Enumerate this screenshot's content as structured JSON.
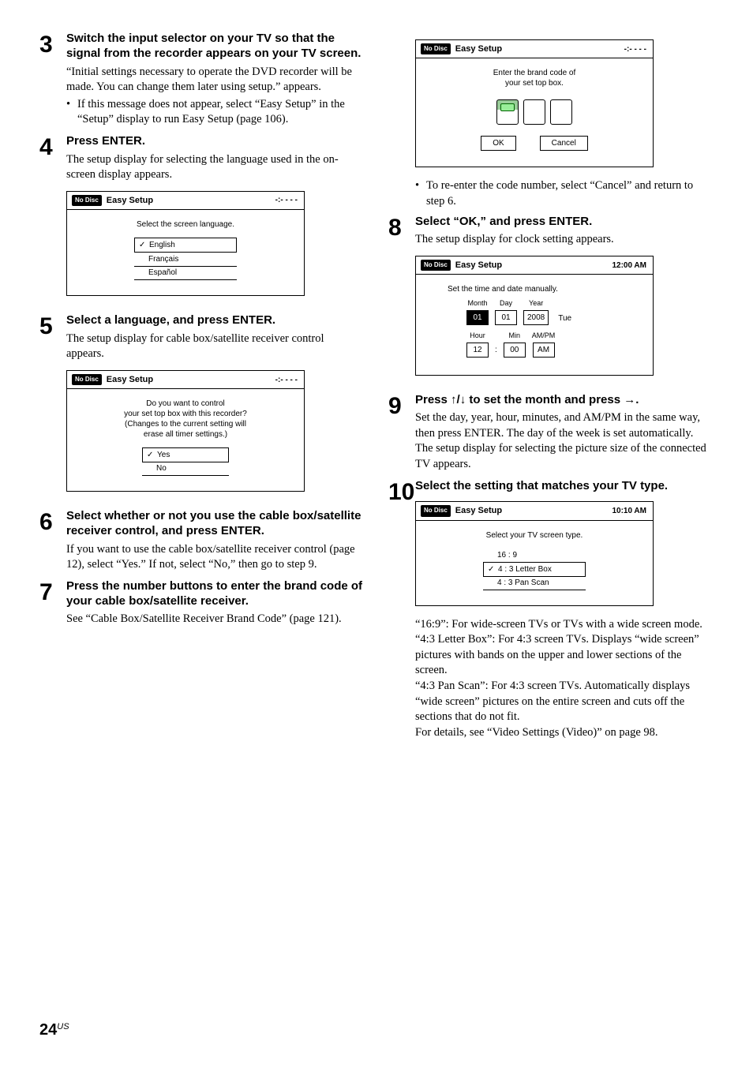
{
  "page_number": "24",
  "page_region": "US",
  "left": {
    "s3": {
      "title": "Switch the input selector on your TV so that the signal from the recorder appears on your TV screen.",
      "p1": "“Initial settings necessary to operate the DVD recorder will be made. You can change them later using setup.” appears.",
      "b1": "If this message does not appear, select “Easy Setup” in the “Setup” display to run Easy Setup (page 106)."
    },
    "s4": {
      "title": "Press ENTER.",
      "p1": "The setup display for selecting the language used in the on-screen display appears."
    },
    "osd_lang": {
      "no_disc": "No Disc",
      "title": "Easy Setup",
      "time": "-:- - - -",
      "msg": "Select the screen language.",
      "opts": [
        "English",
        "Français",
        "Español"
      ]
    },
    "s5": {
      "title": "Select a language, and press ENTER.",
      "p1": "The setup display for cable box/satellite receiver control appears."
    },
    "osd_stb": {
      "no_disc": "No Disc",
      "title": "Easy Setup",
      "time": "-:- - - -",
      "msg1": "Do you want to control",
      "msg2": "your set top box with this recorder?",
      "msg3": "(Changes to the current setting will",
      "msg4": "erase all timer settings.)",
      "opts": [
        "Yes",
        "No"
      ]
    },
    "s6": {
      "title": "Select whether or not you use the cable box/satellite receiver control, and press ENTER.",
      "p1": "If you want to use the cable box/satellite receiver control (page 12), select “Yes.” If not, select “No,” then go to step 9."
    },
    "s7": {
      "title": "Press the number buttons to enter the brand code of your cable box/satellite receiver.",
      "p1": "See “Cable Box/Satellite Receiver Brand Code” (page 121)."
    }
  },
  "right": {
    "osd_brand": {
      "no_disc": "No Disc",
      "title": "Easy Setup",
      "time": "-:- - - -",
      "msg1": "Enter the brand code of",
      "msg2": "your set top box.",
      "btn_ok": "OK",
      "btn_cancel": "Cancel"
    },
    "b1": "To re-enter the code number, select “Cancel” and return to step 6.",
    "s8": {
      "title": "Select “OK,” and press ENTER.",
      "p1": "The setup display for clock setting appears."
    },
    "osd_clock": {
      "no_disc": "No Disc",
      "title": "Easy Setup",
      "time": "12:00 AM",
      "msg": "Set the time and date manually.",
      "labels": {
        "month": "Month",
        "day": "Day",
        "year": "Year",
        "hour": "Hour",
        "min": "Min",
        "ampm": "AM/PM"
      },
      "vals": {
        "month": "01",
        "day": "01",
        "year": "2008",
        "dow": "Tue",
        "hour": "12",
        "min": "00",
        "ampm": "AM"
      }
    },
    "s9": {
      "title_a": "Press ",
      "title_b": " to set the month and press ",
      "title_c": ".",
      "p1": "Set the day, year, hour, minutes, and AM/PM in the same way, then press ENTER. The day of the week is set automatically.",
      "p2": "The setup display for selecting the picture size of the connected TV appears."
    },
    "s10": {
      "title": "Select the setting that matches your TV type."
    },
    "osd_tv": {
      "no_disc": "No Disc",
      "title": "Easy Setup",
      "time": "10:10 AM",
      "msg": "Select your TV screen type.",
      "opts": [
        "16 : 9",
        "4 : 3  Letter Box",
        "4 : 3  Pan Scan"
      ]
    },
    "p_after": {
      "l1": "“16:9”: For wide-screen TVs or TVs with a wide screen mode.",
      "l2": "“4:3 Letter Box”: For 4:3 screen TVs. Displays “wide screen” pictures with bands on the upper and lower sections of the screen.",
      "l3": "“4:3 Pan Scan”: For 4:3 screen TVs. Automatically displays “wide screen” pictures on the entire screen and cuts off the sections that do not fit.",
      "l4": "For details, see “Video Settings (Video)” on page 98."
    }
  }
}
